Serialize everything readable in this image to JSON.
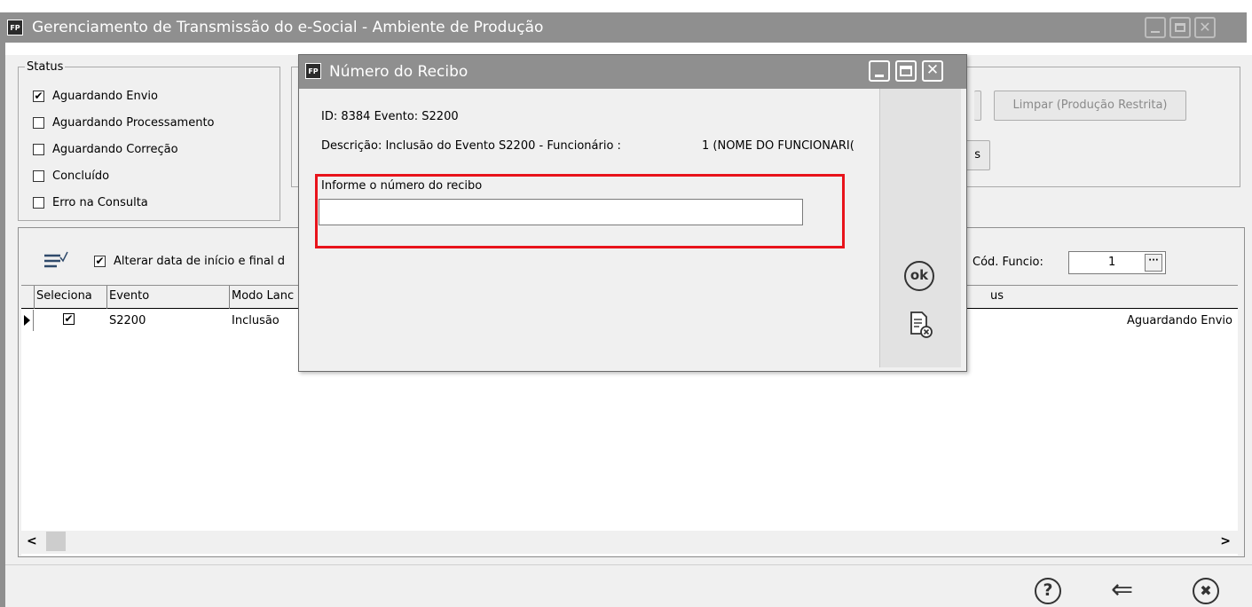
{
  "window": {
    "app_icon": "FP",
    "title": "Gerenciamento de Transmissão do e-Social - Ambiente de Produção"
  },
  "status_group": {
    "title": "Status",
    "items": [
      {
        "label": "Aguardando Envio",
        "checked": true
      },
      {
        "label": "Aguardando Processamento",
        "checked": false
      },
      {
        "label": "Aguardando Correção",
        "checked": false
      },
      {
        "label": "Concluído",
        "checked": false
      },
      {
        "label": "Erro na Consulta",
        "checked": false
      }
    ]
  },
  "actions": {
    "limpar_label": "Limpar (Produção Restrita)",
    "partial_button_text": "s"
  },
  "grid_toolbar": {
    "alterar_data_label": "Alterar data de início e final d",
    "alterar_data_checked": true,
    "cod_funcio_label": "Cód. Funcio:",
    "cod_funcio_value": "1",
    "lookup_glyph": "···"
  },
  "grid": {
    "columns": [
      "Seleciona",
      "Evento",
      "Modo Lanc",
      "us"
    ],
    "rows": [
      {
        "selected": true,
        "evento": "S2200",
        "modo": "Inclusão",
        "status": "Aguardando Envio"
      }
    ],
    "scroll_left": "<",
    "scroll_right": ">"
  },
  "dialog": {
    "app_icon": "FP",
    "title": "Número do Recibo",
    "id_line": "ID: 8384 Evento: S2200",
    "descricao_line": "Descrição: Inclusão do Evento S2200 - Funcionário :",
    "funcionario": "1 (NOME DO FUNCIONÁRI(",
    "input_label": "Informe o número do recibo",
    "input_value": "",
    "ok_label": "ok"
  },
  "bottom": {
    "help_glyph": "?",
    "back_glyph": "⇐",
    "close_glyph": "✖"
  },
  "colors": {
    "titlebar": "#8f8f8f",
    "highlight_box": "#e8131b",
    "background": "#f0f0f0"
  }
}
